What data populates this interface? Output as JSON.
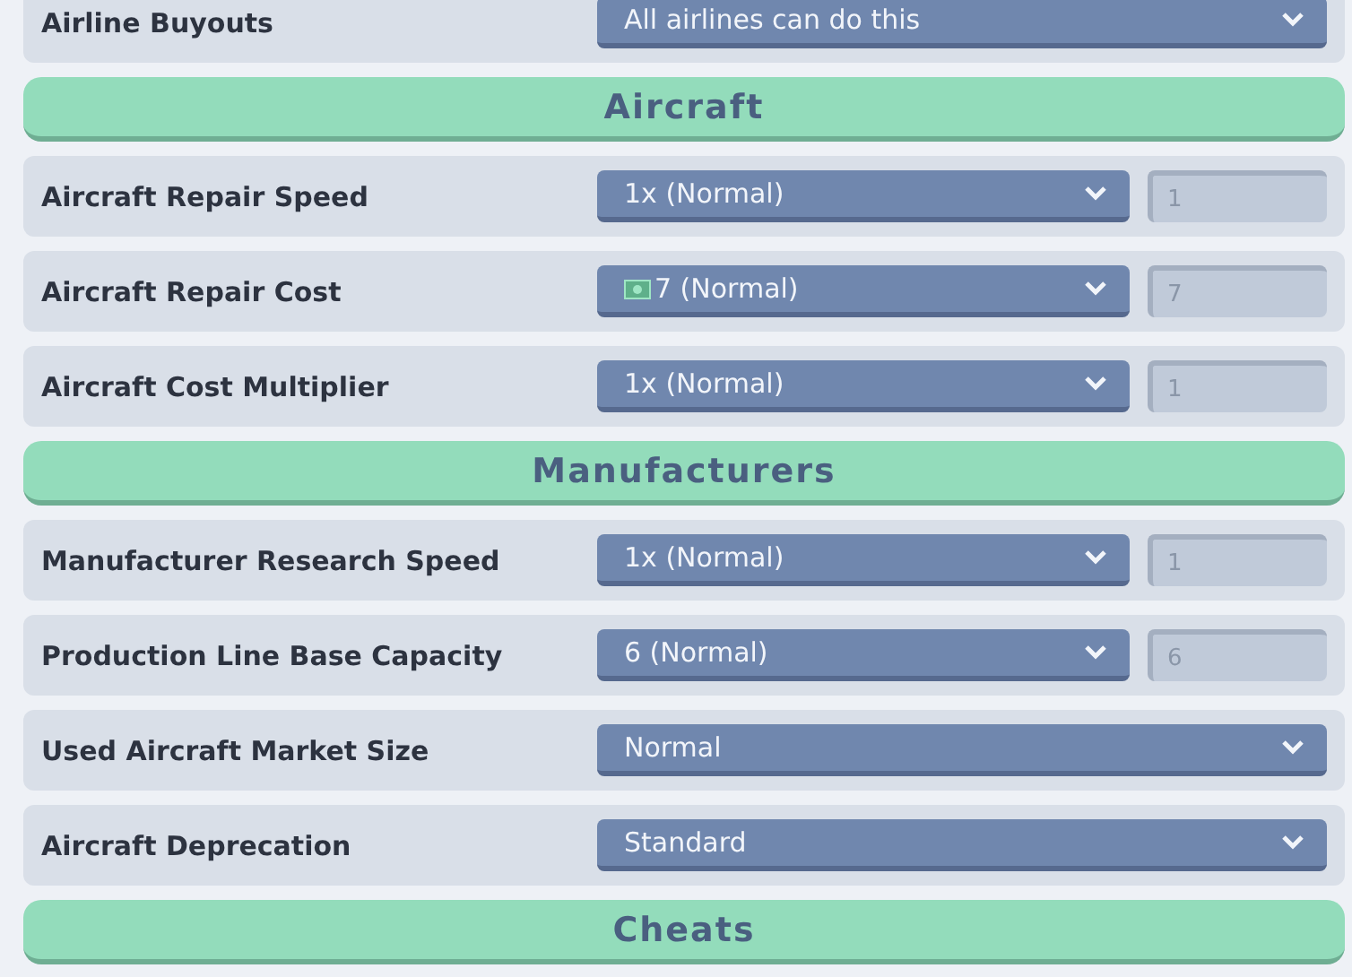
{
  "items": [
    {
      "kind": "setting",
      "label": "Airline Buyouts",
      "dropdown": {
        "value": "All airlines can do this"
      }
    },
    {
      "kind": "header",
      "label": "Aircraft"
    },
    {
      "kind": "setting",
      "label": "Aircraft Repair Speed",
      "dropdown": {
        "value": "1x (Normal)"
      },
      "field": {
        "value": "1",
        "disabled": true
      }
    },
    {
      "kind": "setting",
      "label": "Aircraft Repair Cost",
      "dropdown": {
        "value": "7 (Normal)",
        "money_icon": true
      },
      "field": {
        "value": "7",
        "disabled": true
      }
    },
    {
      "kind": "setting",
      "label": "Aircraft Cost Multiplier",
      "dropdown": {
        "value": "1x (Normal)"
      },
      "field": {
        "value": "1",
        "disabled": true
      }
    },
    {
      "kind": "header",
      "label": "Manufacturers"
    },
    {
      "kind": "setting",
      "label": "Manufacturer Research Speed",
      "dropdown": {
        "value": "1x (Normal)"
      },
      "field": {
        "value": "1",
        "disabled": true
      }
    },
    {
      "kind": "setting",
      "label": "Production Line Base Capacity",
      "dropdown": {
        "value": "6 (Normal)"
      },
      "field": {
        "value": "6",
        "disabled": true
      }
    },
    {
      "kind": "setting",
      "label": "Used Aircraft Market Size",
      "dropdown": {
        "value": "Normal"
      }
    },
    {
      "kind": "setting",
      "label": "Aircraft Deprecation",
      "dropdown": {
        "value": "Standard"
      }
    },
    {
      "kind": "header",
      "label": "Cheats"
    }
  ]
}
